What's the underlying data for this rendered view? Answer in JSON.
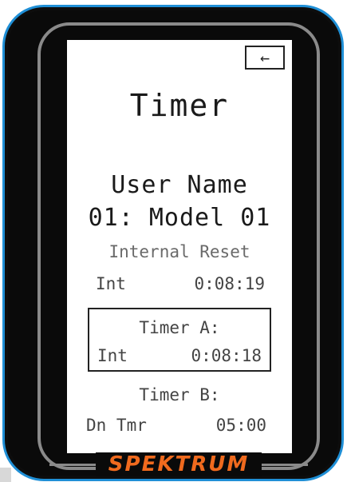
{
  "screen": {
    "title": "Timer",
    "back_icon": "←",
    "user_name_label": "User Name",
    "model_name": "01: Model 01",
    "internal_reset_label": "Internal Reset",
    "internal": {
      "mode": "Int",
      "time": "0:08:19"
    },
    "timer_a": {
      "label": "Timer A:",
      "mode": "Int",
      "time": "0:08:18"
    },
    "timer_b": {
      "label": "Timer B:",
      "mode": "Dn Tmr",
      "time": "05:00"
    }
  },
  "device": {
    "brand": "SPEKTRUM"
  },
  "colors": {
    "bezel": "#0a0a0a",
    "bezel_edge": "#1f8fd6",
    "frame": "#8a8a8a",
    "brand": "#f06a1e"
  },
  "icons": {
    "back": "back-arrow-icon"
  }
}
